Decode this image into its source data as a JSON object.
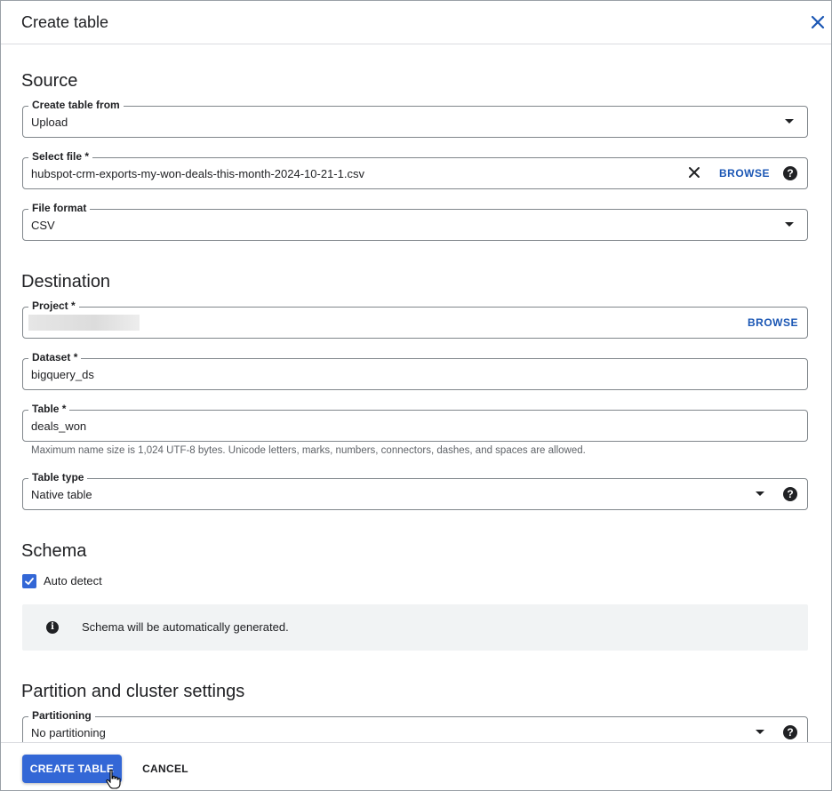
{
  "dialog": {
    "title": "Create table",
    "close_icon": "close-icon"
  },
  "source": {
    "heading": "Source",
    "create_from": {
      "label": "Create table from",
      "value": "Upload"
    },
    "select_file": {
      "label": "Select file *",
      "value": "hubspot-crm-exports-my-won-deals-this-month-2024-10-21-1.csv",
      "browse": "BROWSE"
    },
    "file_format": {
      "label": "File format",
      "value": "CSV"
    }
  },
  "destination": {
    "heading": "Destination",
    "project": {
      "label": "Project *",
      "browse": "BROWSE"
    },
    "dataset": {
      "label": "Dataset *",
      "value": "bigquery_ds"
    },
    "table": {
      "label": "Table *",
      "value": "deals_won",
      "hint": "Maximum name size is 1,024 UTF-8 bytes. Unicode letters, marks, numbers, connectors, dashes, and spaces are allowed."
    },
    "table_type": {
      "label": "Table type",
      "value": "Native table"
    }
  },
  "schema": {
    "heading": "Schema",
    "auto_detect_label": "Auto detect",
    "auto_detect_checked": true,
    "info_text": "Schema will be automatically generated."
  },
  "partition": {
    "heading": "Partition and cluster settings",
    "partitioning": {
      "label": "Partitioning",
      "value": "No partitioning"
    }
  },
  "footer": {
    "create_label": "CREATE TABLE",
    "cancel_label": "CANCEL"
  },
  "colors": {
    "accent": "#3367d6",
    "link": "#1a56b4"
  }
}
